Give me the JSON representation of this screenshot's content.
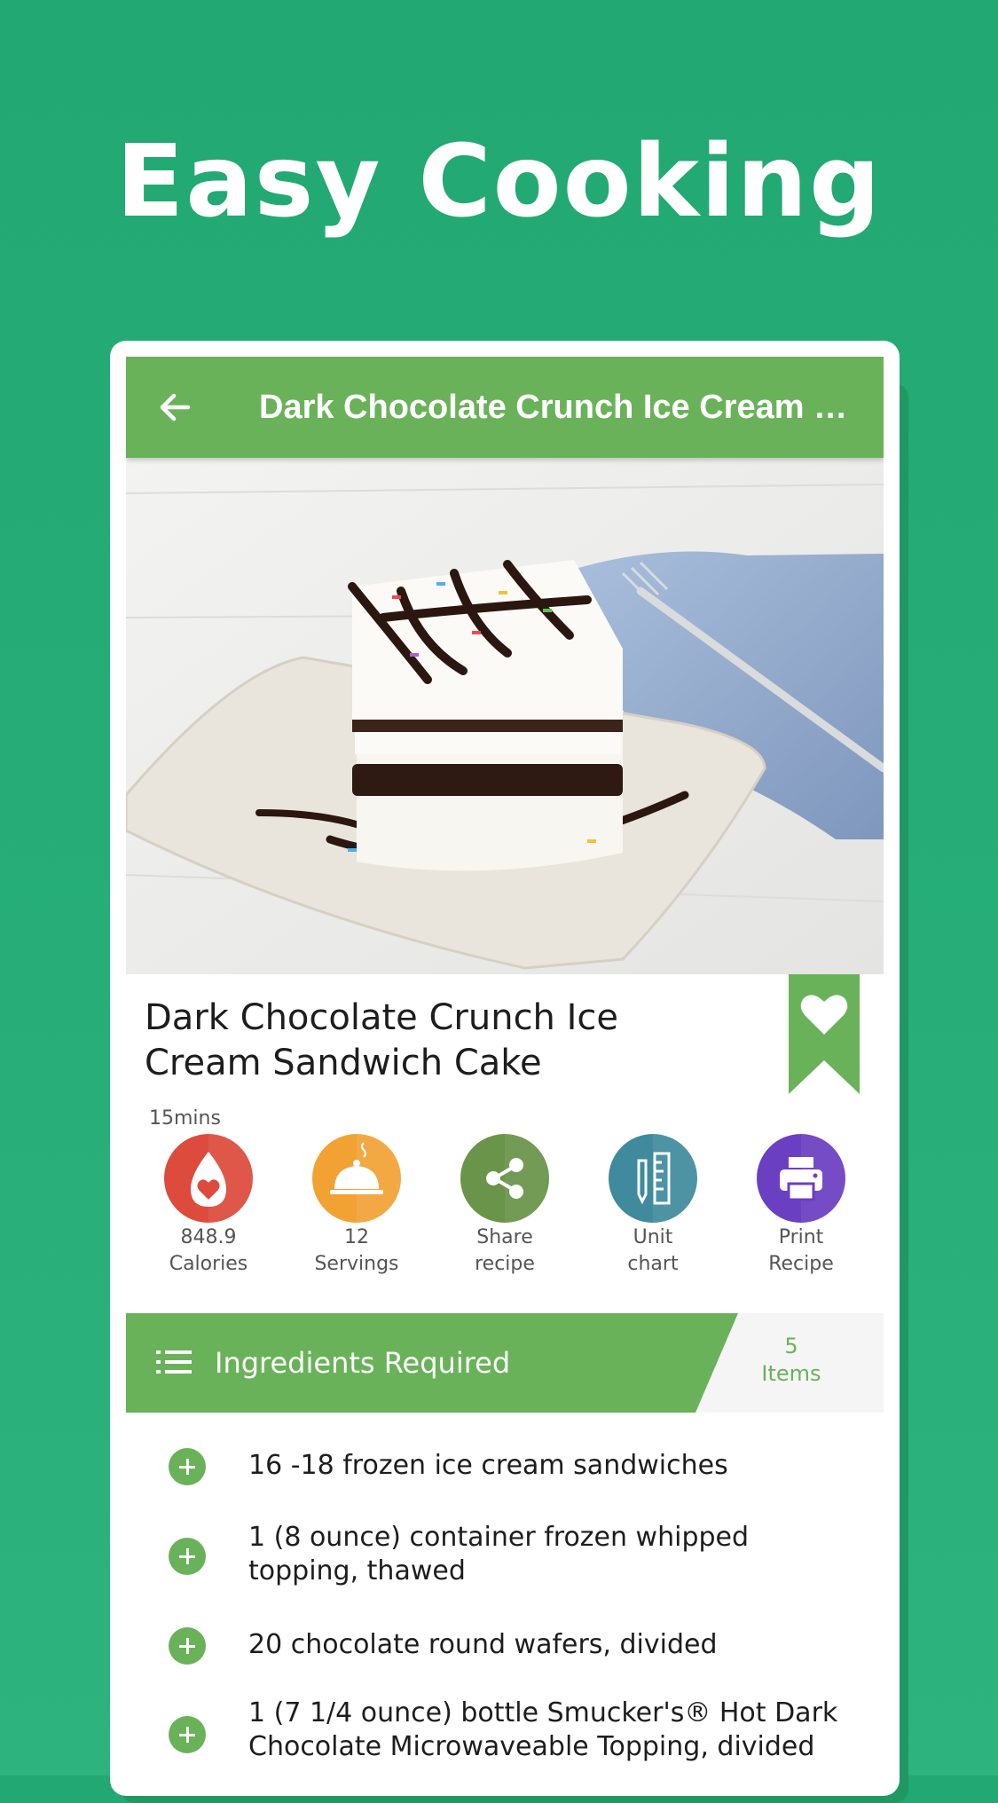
{
  "headline": "Easy Cooking",
  "appbar": {
    "title": "Dark Chocolate Crunch Ice Cream Sandwich Cake",
    "back_icon": "arrow-left-icon"
  },
  "recipe": {
    "title_line1": "Dark Chocolate Crunch Ice",
    "title_line2": "Cream Sandwich Cake",
    "time": "15mins",
    "favorite_icon": "heart-bookmark-icon"
  },
  "actions": [
    {
      "line1": "848.9",
      "line2": "Calories",
      "icon": "calories-flame-heart-icon",
      "color": "#dd4b3c"
    },
    {
      "line1": "12",
      "line2": "Servings",
      "icon": "serving-cloche-icon",
      "color": "#f2a233"
    },
    {
      "line1": "Share",
      "line2": "recipe",
      "icon": "share-icon",
      "color": "#6a944a"
    },
    {
      "line1": "Unit",
      "line2": "chart",
      "icon": "ruler-icon",
      "color": "#3f8a9c"
    },
    {
      "line1": "Print",
      "line2": "Recipe",
      "icon": "printer-icon",
      "color": "#6b3fc2"
    }
  ],
  "ingredients": {
    "title": "Ingredients Required",
    "count_number": "5",
    "count_label": "Items",
    "items": [
      {
        "line1": "16 -18 frozen ice cream sandwiches",
        "line2": ""
      },
      {
        "line1": "1 (8 ounce) container frozen whipped",
        "line2": "topping, thawed"
      },
      {
        "line1": "20 chocolate round wafers, divided",
        "line2": ""
      },
      {
        "line1": "1 (7 1/4 ounce) bottle Smucker's® Hot Dark",
        "line2": "Chocolate Microwaveable Topping, divided"
      }
    ]
  },
  "colors": {
    "background": "#22a872",
    "accent_green": "#6ab259",
    "calories": "#dd4b3c",
    "servings": "#f2a233",
    "share": "#6a944a",
    "unit": "#3f8a9c",
    "print": "#6b3fc2"
  }
}
